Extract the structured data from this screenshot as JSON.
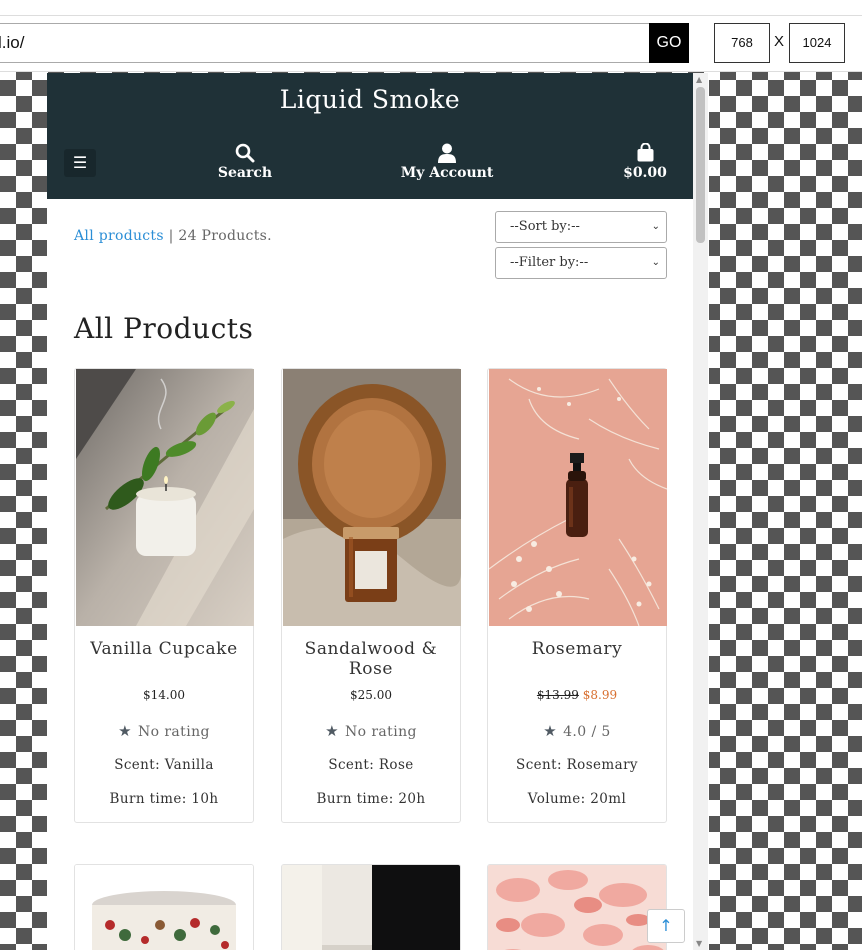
{
  "toolbar": {
    "url": "l.io/",
    "go_label": "GO",
    "width_value": "768",
    "separator": "X",
    "height_value": "1024"
  },
  "site": {
    "brand": "Liquid Smoke",
    "nav": {
      "search": "Search",
      "account": "My Account",
      "cart_total": "$0.00"
    }
  },
  "listing": {
    "crumb_link": "All products",
    "crumb_sep": " | ",
    "count": "24 Products.",
    "sort_selected": "--Sort by:--",
    "filter_selected": "--Filter by:--",
    "heading": "All Products"
  },
  "products": [
    {
      "name": "Vanilla Cupcake",
      "price": "$14.00",
      "rating": "No rating",
      "detail1": "Scent: Vanilla",
      "detail2": "Burn time: 10h"
    },
    {
      "name": "Sandalwood & Rose",
      "price": "$25.00",
      "rating": "No rating",
      "detail1": "Scent: Rose",
      "detail2": "Burn time: 20h"
    },
    {
      "name": "Rosemary",
      "old_price": "$13.99",
      "sale_price": "$8.99",
      "rating": "4.0 / 5",
      "detail1": "Scent: Rosemary",
      "detail2": "Volume: 20ml"
    }
  ],
  "colors": {
    "header_bg": "#1f3137",
    "link": "#2b8ed6",
    "sale": "#d86f2f"
  },
  "icons": {
    "menu": "bars-icon",
    "search": "search-icon",
    "account": "user-icon",
    "cart": "shopping-bag-icon",
    "star": "star-icon",
    "back_to_top": "arrow-up-icon"
  }
}
